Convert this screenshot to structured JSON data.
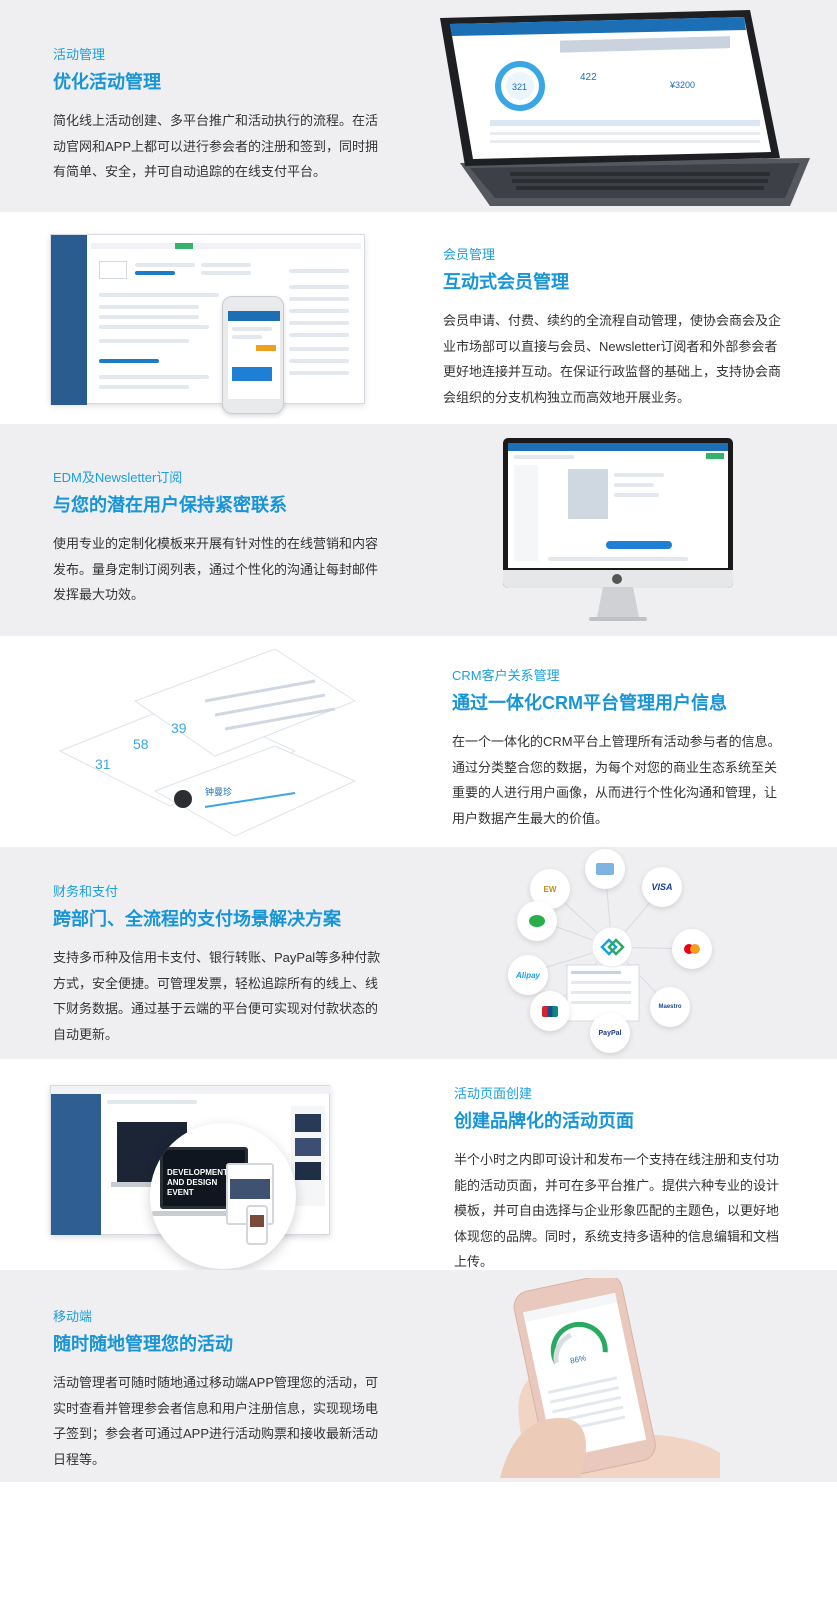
{
  "sections": [
    {
      "eyebrow": "活动管理",
      "title": "优化活动管理",
      "body": "简化线上活动创建、多平台推广和活动执行的流程。在活动官网和APP上都可以进行参会者的注册和签到，同时拥有简单、安全，并可自动追踪的在线支付平台。"
    },
    {
      "eyebrow": "会员管理",
      "title": "互动式会员管理",
      "body": "会员申请、付费、续约的全流程自动管理，使协会商会及企业市场部可以直接与会员、Newsletter订阅者和外部参会者更好地连接并互动。在保证行政监督的基础上，支持协会商会组织的分支机构独立而高效地开展业务。"
    },
    {
      "eyebrow": "EDM及Newsletter订阅",
      "title": "与您的潜在用户保持紧密联系",
      "body": "使用专业的定制化模板来开展有针对性的在线营销和内容发布。量身定制订阅列表，通过个性化的沟通让每封邮件发挥最大功效。"
    },
    {
      "eyebrow": "CRM客户关系管理",
      "title": "通过一体化CRM平台管理用户信息",
      "body": "在一个一体化的CRM平台上管理所有活动参与者的信息。通过分类整合您的数据，为每个对您的商业生态系统至关重要的人进行用户画像，从而进行个性化沟通和管理，让用户数据产生最大的价值。"
    },
    {
      "eyebrow": "财务和支付",
      "title": "跨部门、全流程的支付场景解决方案",
      "body": "支持多币种及信用卡支付、银行转账、PayPal等多种付款方式，安全便捷。可管理发票，轻松追踪所有的线上、线下财务数据。通过基于云端的平台便可实现对付款状态的自动更新。"
    },
    {
      "eyebrow": "活动页面创建",
      "title": "创建品牌化的活动页面",
      "body": "半个小时之内即可设计和发布一个支持在线注册和支付功能的活动页面，并可在多平台推广。提供六种专业的设计模板，并可自由选择与企业形象匹配的主题色，以更好地体现您的品牌。同时，系统支持多语种的信息编辑和文档上传。"
    },
    {
      "eyebrow": "移动端",
      "title": "随时随地管理您的活动",
      "body": "活动管理者可随时随地通过移动端APP管理您的活动，可实时查看并管理参会者信息和用户注册信息，实现现场电子签到；参会者可通过APP进行活动购票和接收最新活动日程等。"
    }
  ],
  "illustrations": {
    "crm_card_name": "钟曼珍",
    "crm_stats": [
      "31",
      "58",
      "39"
    ],
    "mobile_percent": "86%",
    "event_page_headline": "DEVELOPMENT AND DESIGN EVENT",
    "payments": [
      "VISA",
      "PayPal",
      "Alipay",
      "Maestro"
    ]
  },
  "colors": {
    "accent": "#1795d6",
    "gray_band": "#efeef1",
    "text": "#333333"
  }
}
